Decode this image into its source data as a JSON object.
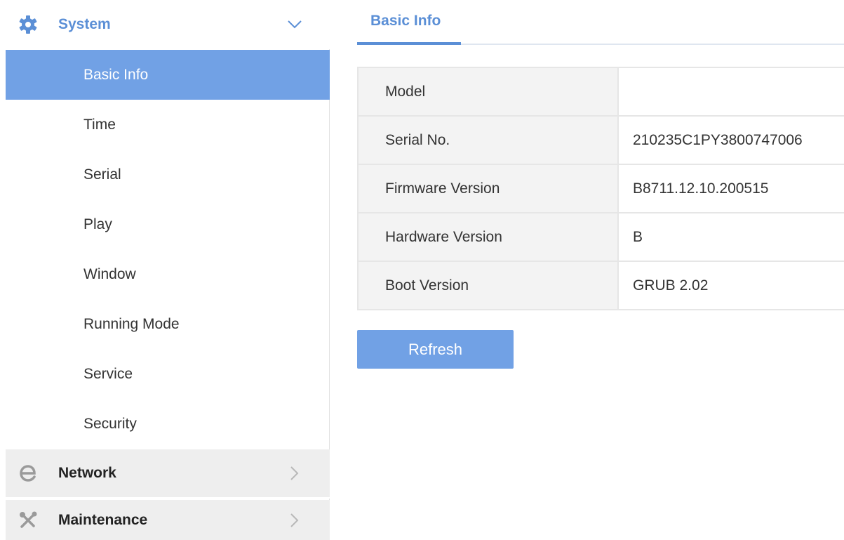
{
  "sidebar": {
    "system": {
      "label": "System",
      "icon": "gear-icon",
      "expanded": true,
      "items": [
        {
          "label": "Basic Info",
          "active": true
        },
        {
          "label": "Time"
        },
        {
          "label": "Serial"
        },
        {
          "label": "Play"
        },
        {
          "label": "Window"
        },
        {
          "label": "Running Mode"
        },
        {
          "label": "Service"
        },
        {
          "label": "Security"
        }
      ]
    },
    "network": {
      "label": "Network",
      "icon": "network-e-icon"
    },
    "maintenance": {
      "label": "Maintenance",
      "icon": "tools-icon"
    }
  },
  "main": {
    "tab": "Basic Info",
    "table": [
      {
        "key": "Model",
        "value": ""
      },
      {
        "key": "Serial No.",
        "value": "210235C1PY3800747006"
      },
      {
        "key": "Firmware Version",
        "value": "B8711.12.10.200515"
      },
      {
        "key": "Hardware Version",
        "value": "B"
      },
      {
        "key": "Boot Version",
        "value": "GRUB 2.02"
      }
    ],
    "refresh_label": "Refresh"
  },
  "colors": {
    "accent": "#5b8fd6",
    "active_bg": "#71a1e5",
    "collapsed_bg": "#eeeeee",
    "key_cell_bg": "#f3f3f3"
  }
}
